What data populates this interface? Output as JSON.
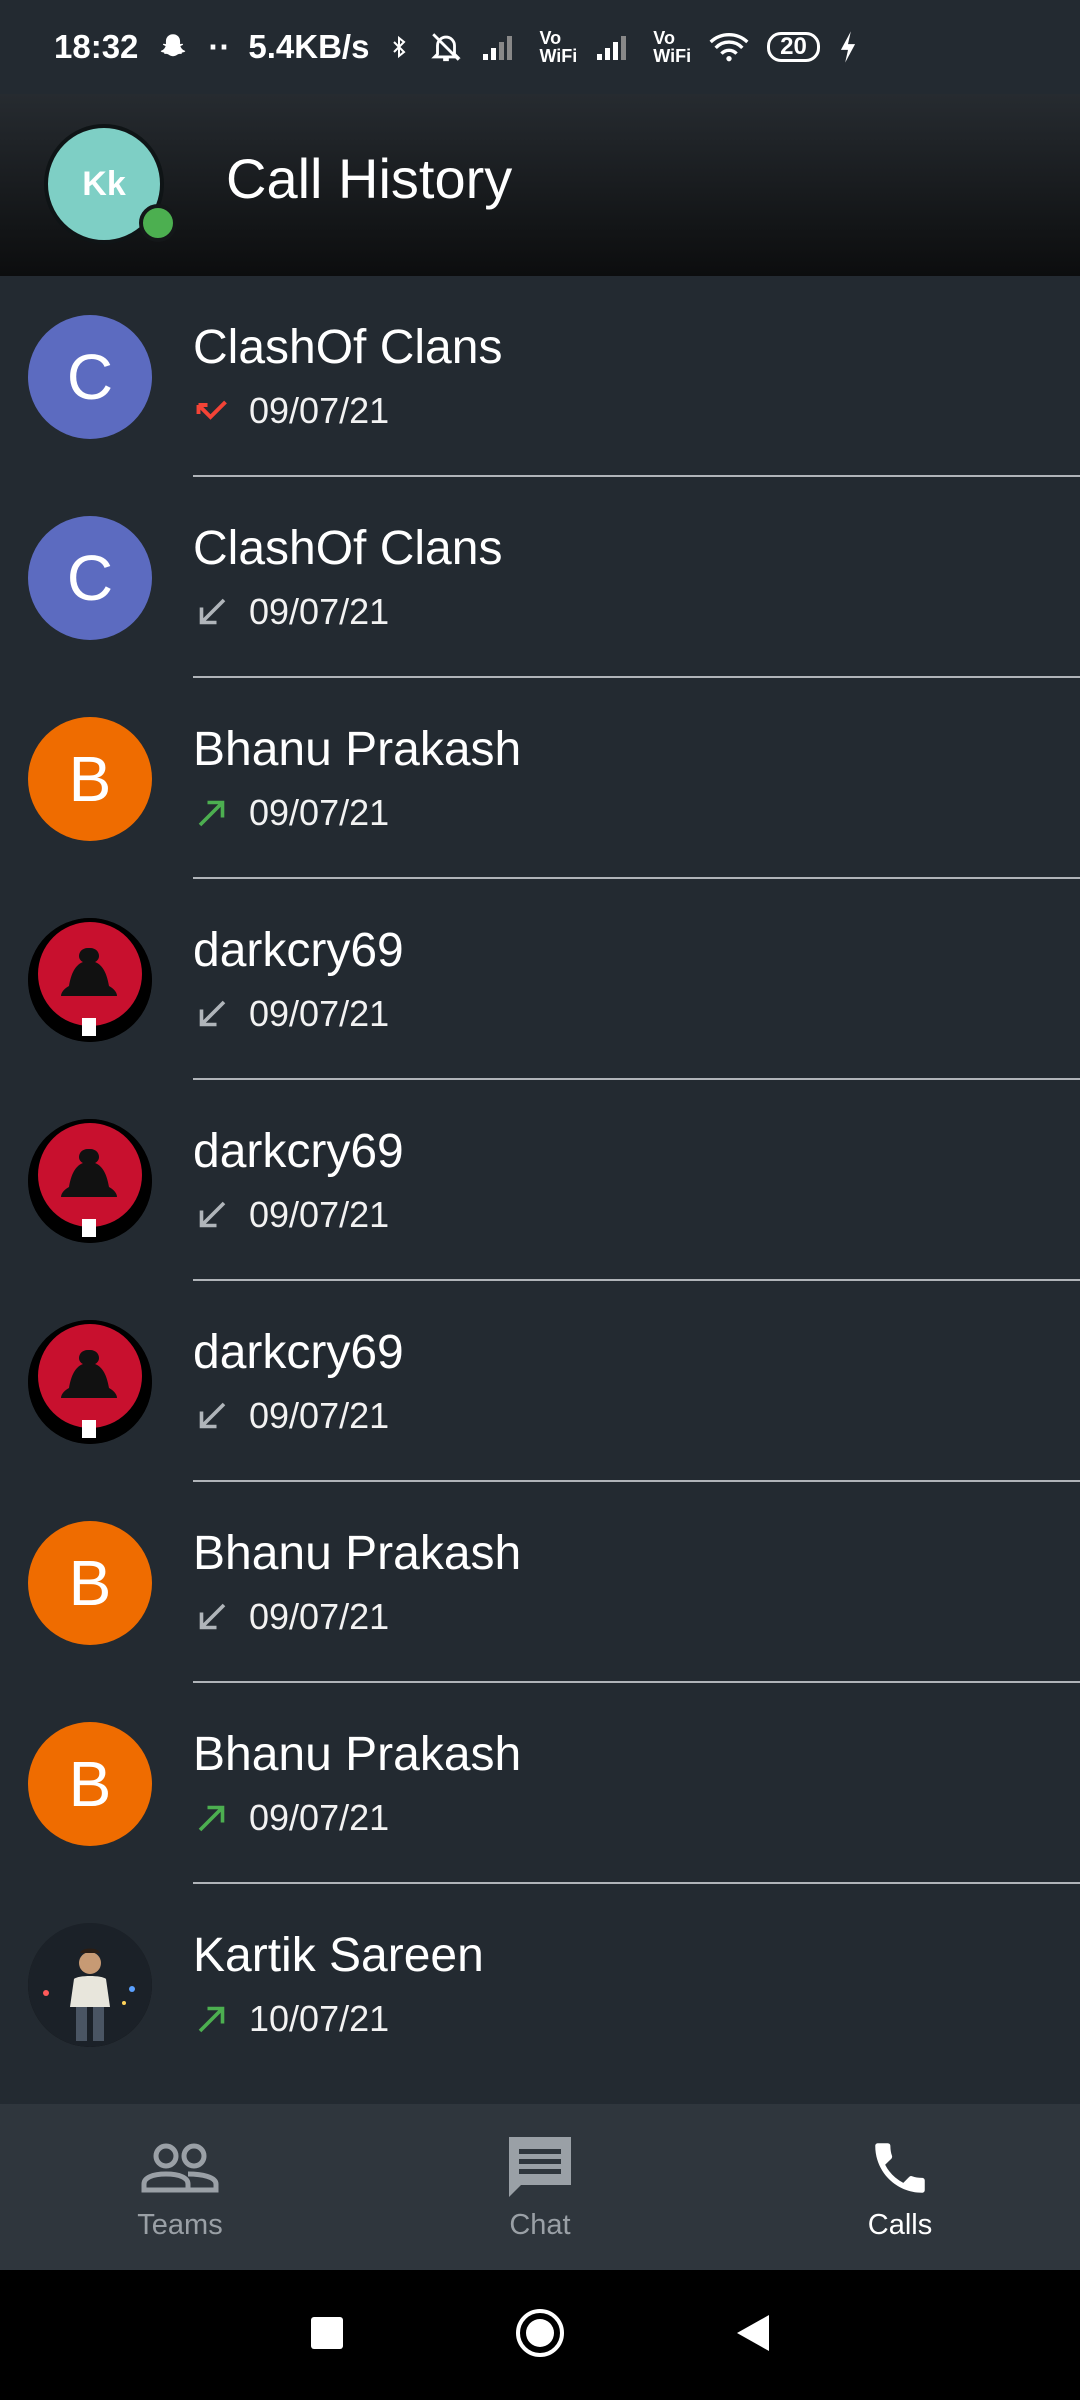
{
  "status_bar": {
    "time": "18:32",
    "dots": "··",
    "speed": "5.4KB/s",
    "battery": "20"
  },
  "header": {
    "avatar_initials": "Kk",
    "title": "Call History"
  },
  "calls": [
    {
      "name": "ClashOf Clans",
      "avatar_letter": "C",
      "avatar_type": "blue",
      "direction": "missed",
      "date": "09/07/21"
    },
    {
      "name": "ClashOf Clans",
      "avatar_letter": "C",
      "avatar_type": "blue",
      "direction": "incoming",
      "date": "09/07/21"
    },
    {
      "name": "Bhanu Prakash",
      "avatar_letter": "B",
      "avatar_type": "orange",
      "direction": "outgoing",
      "date": "09/07/21"
    },
    {
      "name": "darkcry69",
      "avatar_letter": "",
      "avatar_type": "photo",
      "direction": "incoming",
      "date": "09/07/21"
    },
    {
      "name": "darkcry69",
      "avatar_letter": "",
      "avatar_type": "photo",
      "direction": "incoming",
      "date": "09/07/21"
    },
    {
      "name": "darkcry69",
      "avatar_letter": "",
      "avatar_type": "photo",
      "direction": "incoming",
      "date": "09/07/21"
    },
    {
      "name": "Bhanu Prakash",
      "avatar_letter": "B",
      "avatar_type": "orange",
      "direction": "incoming",
      "date": "09/07/21"
    },
    {
      "name": "Bhanu Prakash",
      "avatar_letter": "B",
      "avatar_type": "orange",
      "direction": "outgoing",
      "date": "09/07/21"
    },
    {
      "name": "Kartik Sareen",
      "avatar_letter": "",
      "avatar_type": "pic",
      "direction": "outgoing",
      "date": "10/07/21"
    }
  ],
  "bottom_nav": {
    "teams_label": "Teams",
    "chat_label": "Chat",
    "calls_label": "Calls"
  },
  "colors": {
    "missed": "#f44336",
    "incoming": "#b0b5ba",
    "outgoing": "#4caf50"
  }
}
